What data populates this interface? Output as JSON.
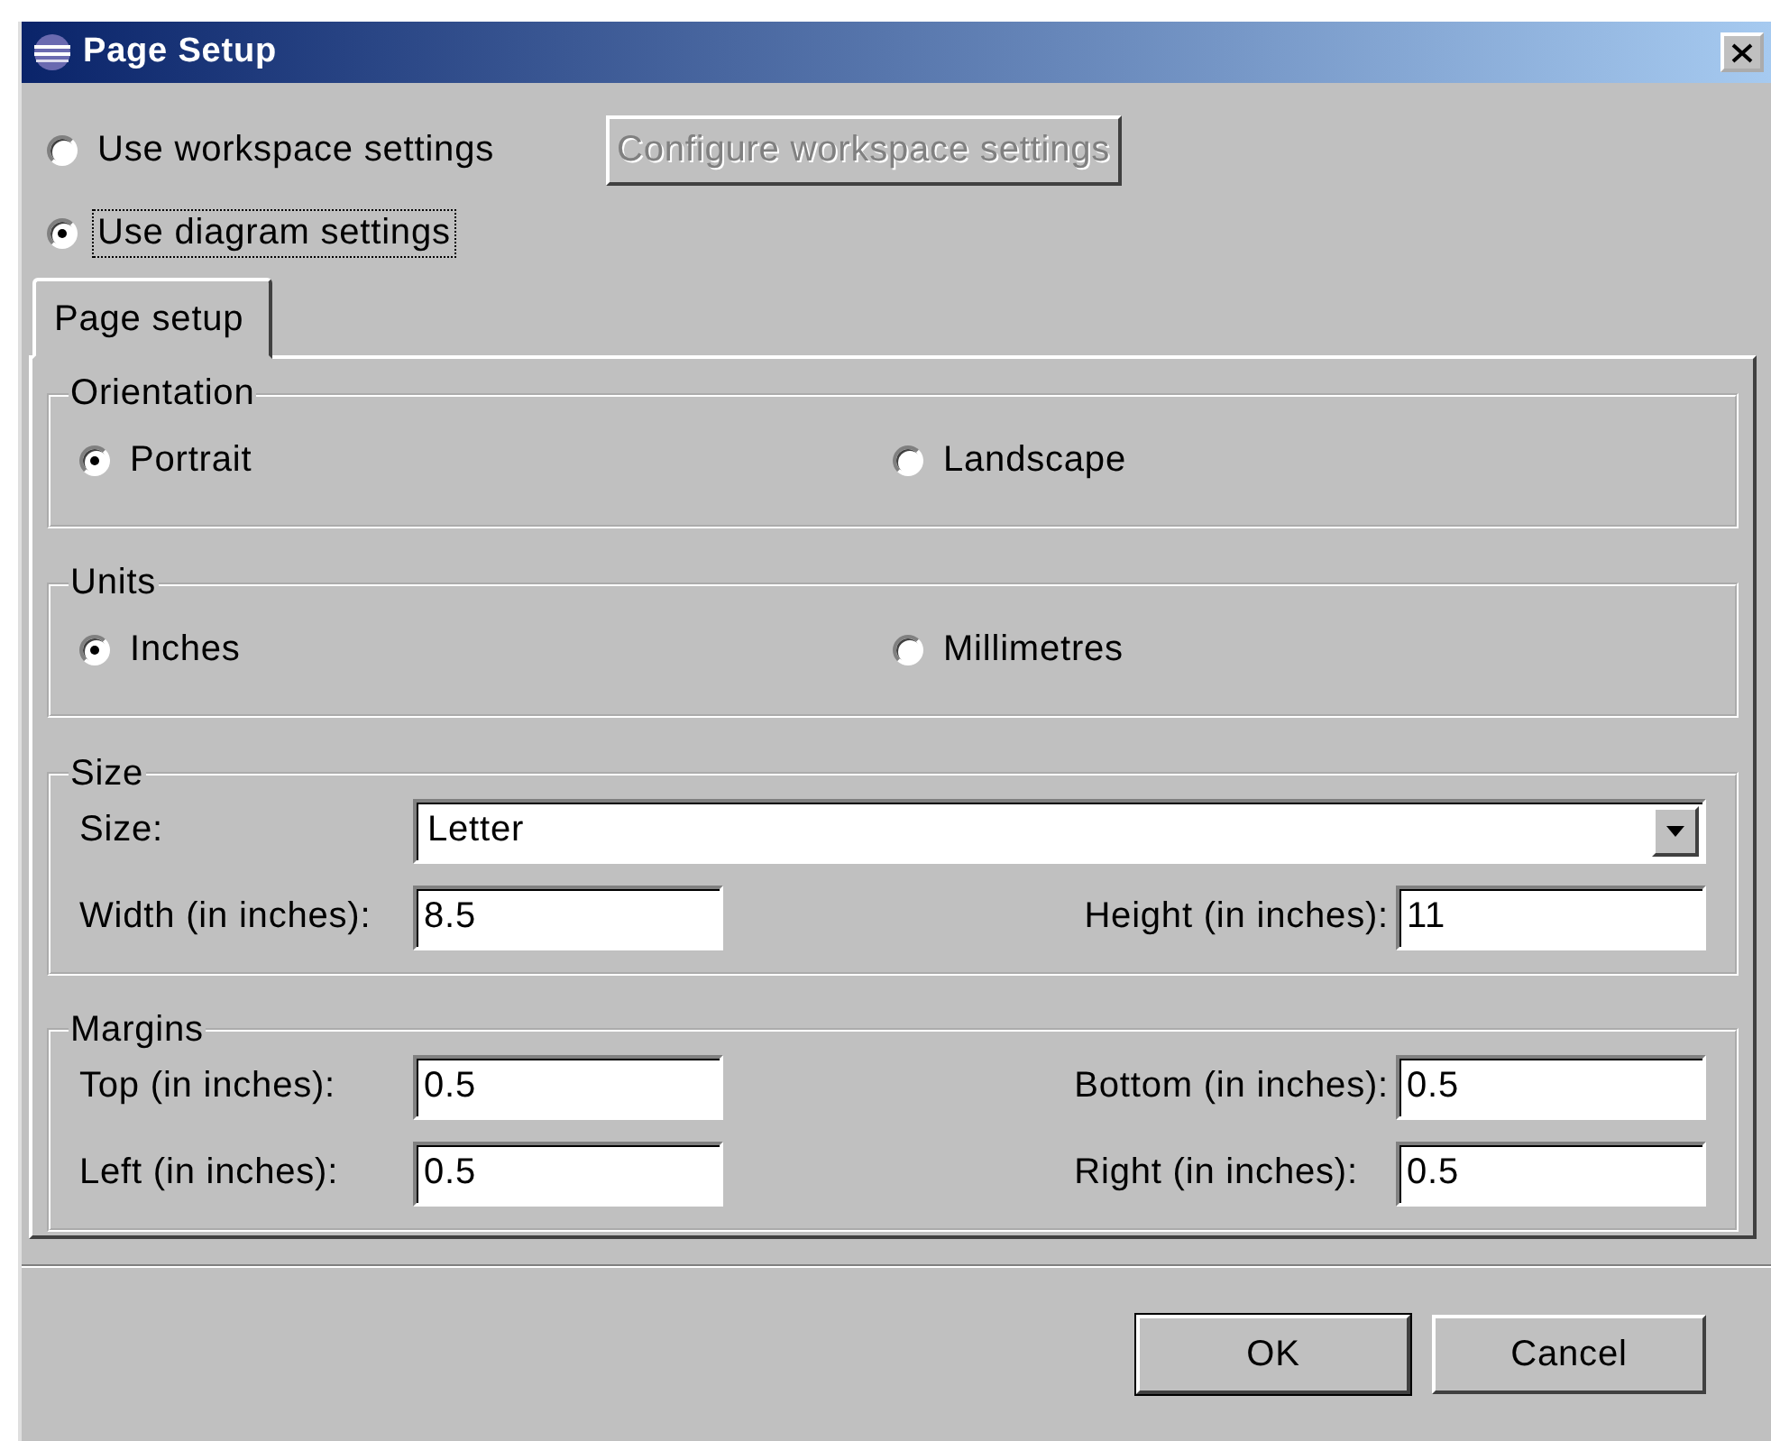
{
  "window": {
    "title": "Page Setup"
  },
  "settings_source": [
    {
      "label": "Use workspace settings",
      "selected": false,
      "focused": false
    },
    {
      "label": "Use diagram settings",
      "selected": true,
      "focused": true
    }
  ],
  "configure_button": {
    "label": "Configure workspace settings",
    "disabled": true
  },
  "tabs": [
    {
      "label": "Page setup",
      "selected": true
    }
  ],
  "groups": [
    {
      "kind": "radios",
      "title": "Orientation",
      "options": [
        {
          "label": "Portrait",
          "selected": true
        },
        {
          "label": "Landscape",
          "selected": false
        }
      ]
    },
    {
      "kind": "radios",
      "title": "Units",
      "options": [
        {
          "label": "Inches",
          "selected": true
        },
        {
          "label": "Millimetres",
          "selected": false
        }
      ]
    },
    {
      "kind": "fields",
      "title": "Size",
      "combo": {
        "label": "Size:",
        "value": "Letter"
      },
      "fields": [
        {
          "label": "Width (in inches):",
          "value": "8.5"
        },
        {
          "label": "Height (in inches):",
          "value": "11"
        }
      ]
    },
    {
      "kind": "fields",
      "title": "Margins",
      "fields": [
        {
          "label": "Top (in inches):",
          "value": "0.5"
        },
        {
          "label": "Bottom (in inches):",
          "value": "0.5"
        },
        {
          "label": "Left (in inches):",
          "value": "0.5"
        },
        {
          "label": "Right (in inches):",
          "value": "0.5"
        }
      ]
    }
  ],
  "buttons": [
    {
      "label": "OK",
      "default": true
    },
    {
      "label": "Cancel",
      "default": false
    }
  ]
}
